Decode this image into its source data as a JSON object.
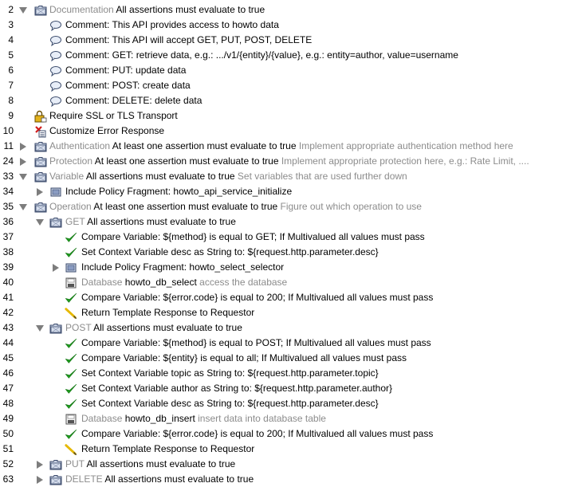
{
  "rows": [
    {
      "num": "2",
      "depth": 0,
      "toggle": "open",
      "icon": "folder-icon",
      "parts": [
        [
          "Documentation",
          "gray"
        ],
        [
          "All assertions must evaluate to true",
          "blk"
        ]
      ]
    },
    {
      "num": "3",
      "depth": 1,
      "toggle": "none",
      "icon": "comment-icon",
      "parts": [
        [
          "Comment: This API provides access to howto data",
          "blk"
        ]
      ]
    },
    {
      "num": "4",
      "depth": 1,
      "toggle": "none",
      "icon": "comment-icon",
      "parts": [
        [
          "Comment: This API will accept GET, PUT, POST, DELETE",
          "blk"
        ]
      ]
    },
    {
      "num": "5",
      "depth": 1,
      "toggle": "none",
      "icon": "comment-icon",
      "parts": [
        [
          "Comment: GET: retrieve data, e.g.: .../v1/{entity}/{value}, e.g.: entity=author, value=username",
          "blk"
        ]
      ]
    },
    {
      "num": "6",
      "depth": 1,
      "toggle": "none",
      "icon": "comment-icon",
      "parts": [
        [
          "Comment: PUT: update data",
          "blk"
        ]
      ]
    },
    {
      "num": "7",
      "depth": 1,
      "toggle": "none",
      "icon": "comment-icon",
      "parts": [
        [
          "Comment: POST: create data",
          "blk"
        ]
      ]
    },
    {
      "num": "8",
      "depth": 1,
      "toggle": "none",
      "icon": "comment-icon",
      "parts": [
        [
          "Comment: DELETE: delete data",
          "blk"
        ]
      ]
    },
    {
      "num": "9",
      "depth": 0,
      "toggle": "none",
      "icon": "ssl-lock-icon",
      "parts": [
        [
          "Require SSL or TLS Transport",
          "blk"
        ]
      ]
    },
    {
      "num": "10",
      "depth": 0,
      "toggle": "none",
      "icon": "error-response-icon",
      "parts": [
        [
          "Customize Error Response",
          "blk"
        ]
      ]
    },
    {
      "num": "11",
      "depth": 0,
      "toggle": "closed",
      "icon": "folder-icon",
      "parts": [
        [
          "Authentication",
          "gray"
        ],
        [
          "At least one assertion must evaluate to true",
          "blk"
        ],
        [
          "Implement appropriate authentication method here",
          "gray"
        ]
      ]
    },
    {
      "num": "24",
      "depth": 0,
      "toggle": "closed",
      "icon": "folder-icon",
      "parts": [
        [
          "Protection",
          "gray"
        ],
        [
          "At least one assertion must evaluate to true",
          "blk"
        ],
        [
          "Implement appropriate protection here, e.g.: Rate Limit, ....",
          "gray"
        ]
      ]
    },
    {
      "num": "33",
      "depth": 0,
      "toggle": "open",
      "icon": "folder-icon",
      "parts": [
        [
          "Variable",
          "gray"
        ],
        [
          "All assertions must evaluate to true",
          "blk"
        ],
        [
          "Set variables that are used further down",
          "gray"
        ]
      ]
    },
    {
      "num": "34",
      "depth": 1,
      "toggle": "closed",
      "icon": "policy-fragment-icon",
      "parts": [
        [
          "Include Policy Fragment: howto_api_service_initialize",
          "blk"
        ]
      ]
    },
    {
      "num": "35",
      "depth": 0,
      "toggle": "open",
      "icon": "folder-icon",
      "parts": [
        [
          "Operation",
          "gray"
        ],
        [
          "At least one assertion must evaluate to true",
          "blk"
        ],
        [
          "Figure out which operation to use",
          "gray"
        ]
      ]
    },
    {
      "num": "36",
      "depth": 1,
      "toggle": "open",
      "icon": "folder-icon",
      "parts": [
        [
          "GET",
          "gray"
        ],
        [
          "All assertions must evaluate to true",
          "blk"
        ]
      ]
    },
    {
      "num": "37",
      "depth": 2,
      "toggle": "none",
      "icon": "checkmark-icon",
      "parts": [
        [
          "Compare Variable: ${method} is equal to GET; If Multivalued all values must pass",
          "blk"
        ]
      ]
    },
    {
      "num": "38",
      "depth": 2,
      "toggle": "none",
      "icon": "checkmark-icon",
      "parts": [
        [
          "Set Context Variable desc as String to: ${request.http.parameter.desc}",
          "blk"
        ]
      ]
    },
    {
      "num": "39",
      "depth": 2,
      "toggle": "closed",
      "icon": "policy-fragment-icon",
      "parts": [
        [
          "Include Policy Fragment: howto_select_selector",
          "blk"
        ]
      ]
    },
    {
      "num": "40",
      "depth": 2,
      "toggle": "none",
      "icon": "database-icon",
      "parts": [
        [
          "Database",
          "gray"
        ],
        [
          "howto_db_select",
          "blk"
        ],
        [
          "access the database",
          "gray"
        ]
      ]
    },
    {
      "num": "41",
      "depth": 2,
      "toggle": "none",
      "icon": "checkmark-icon",
      "parts": [
        [
          "Compare Variable: ${error.code} is equal to 200; If Multivalued all values must pass",
          "blk"
        ]
      ]
    },
    {
      "num": "42",
      "depth": 2,
      "toggle": "none",
      "icon": "pencil-icon",
      "parts": [
        [
          "Return Template Response to Requestor",
          "blk"
        ]
      ]
    },
    {
      "num": "43",
      "depth": 1,
      "toggle": "open",
      "icon": "folder-icon",
      "parts": [
        [
          "POST",
          "gray"
        ],
        [
          "All assertions must evaluate to true",
          "blk"
        ]
      ]
    },
    {
      "num": "44",
      "depth": 2,
      "toggle": "none",
      "icon": "checkmark-icon",
      "parts": [
        [
          "Compare Variable: ${method} is equal to POST; If Multivalued all values must pass",
          "blk"
        ]
      ]
    },
    {
      "num": "45",
      "depth": 2,
      "toggle": "none",
      "icon": "checkmark-icon",
      "parts": [
        [
          "Compare Variable: ${entity} is equal to all; If Multivalued all values must pass",
          "blk"
        ]
      ]
    },
    {
      "num": "46",
      "depth": 2,
      "toggle": "none",
      "icon": "checkmark-icon",
      "parts": [
        [
          "Set Context Variable topic as String to: ${request.http.parameter.topic}",
          "blk"
        ]
      ]
    },
    {
      "num": "47",
      "depth": 2,
      "toggle": "none",
      "icon": "checkmark-icon",
      "parts": [
        [
          "Set Context Variable author as String to: ${request.http.parameter.author}",
          "blk"
        ]
      ]
    },
    {
      "num": "48",
      "depth": 2,
      "toggle": "none",
      "icon": "checkmark-icon",
      "parts": [
        [
          "Set Context Variable desc as String to: ${request.http.parameter.desc}",
          "blk"
        ]
      ]
    },
    {
      "num": "49",
      "depth": 2,
      "toggle": "none",
      "icon": "database-icon",
      "parts": [
        [
          "Database",
          "gray"
        ],
        [
          "howto_db_insert",
          "blk"
        ],
        [
          "insert data into database table",
          "gray"
        ]
      ]
    },
    {
      "num": "50",
      "depth": 2,
      "toggle": "none",
      "icon": "checkmark-icon",
      "parts": [
        [
          "Compare Variable: ${error.code} is equal to 200; If Multivalued all values must pass",
          "blk"
        ]
      ]
    },
    {
      "num": "51",
      "depth": 2,
      "toggle": "none",
      "icon": "pencil-icon",
      "parts": [
        [
          "Return Template Response to Requestor",
          "blk"
        ]
      ]
    },
    {
      "num": "52",
      "depth": 1,
      "toggle": "closed",
      "icon": "folder-icon",
      "parts": [
        [
          "PUT",
          "gray"
        ],
        [
          "All assertions must evaluate to true",
          "blk"
        ]
      ]
    },
    {
      "num": "63",
      "depth": 1,
      "toggle": "closed",
      "icon": "folder-icon",
      "parts": [
        [
          "DELETE",
          "gray"
        ],
        [
          "All assertions must evaluate to true",
          "blk"
        ]
      ]
    }
  ]
}
